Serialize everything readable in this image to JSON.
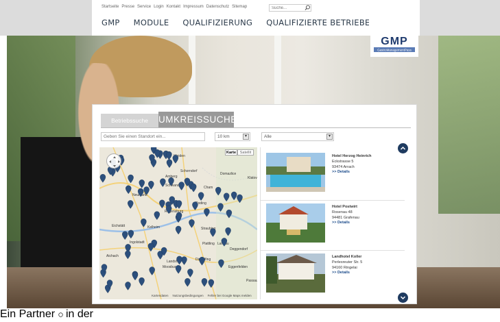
{
  "meta_nav": [
    "Startseite",
    "Presse",
    "Service",
    "Login",
    "Kontakt",
    "Impressum",
    "Datenschutz",
    "Sitemap"
  ],
  "search": {
    "placeholder": "Suche..."
  },
  "main_nav": [
    "GMP",
    "MODULE",
    "QUALIFIZIERUNG",
    "QUALIFIZIERTE BETRIEBE"
  ],
  "logo": {
    "text": "GMP",
    "subtext": "GastroManagementPass"
  },
  "tabs": {
    "inactive": "Betriebssuche",
    "active": "UMKREISSUCHE"
  },
  "filters": {
    "location_placeholder": "Geben Sie einen Standort ein...",
    "radius": "10 km",
    "category": "Alle"
  },
  "map": {
    "type_buttons": [
      "Karte",
      "Satellit"
    ],
    "labels": [
      "Weiden",
      "Schwandorf",
      "Amberg",
      "Neumarkt",
      "Roding",
      "Cham",
      "Regensburg",
      "Straubing",
      "Deggendorf",
      "Plattling",
      "Landau",
      "Dingolfing",
      "Landshut",
      "Aichach",
      "Moosburg",
      "Eggenfelden",
      "Passau",
      "Klatovy",
      "Domazlice",
      "Eichstätt",
      "Ingolstadt",
      "Kelheim",
      "Schorndorf"
    ],
    "footer": [
      "Kartendaten",
      "Nutzungsbedingungen",
      "Fehler bei Google Maps melden"
    ]
  },
  "hotels": [
    {
      "name": "Hotel Herzog Heinrich",
      "street": "Eckstrasse 5",
      "city": "93474 Arrach",
      "link": ">> Details"
    },
    {
      "name": "Hotel Postwirt",
      "street": "Rosenau 48",
      "city": "94481 Grafenau",
      "link": ">> Details"
    },
    {
      "name": "Landhotel Koller",
      "street": "Perlesreuter Str. 5",
      "city": "94160 Ringelai",
      "link": ">> Details"
    }
  ],
  "footer": {
    "copyright": "© ...",
    "right_links": [
      "Ein Partner",
      "in der"
    ]
  },
  "colors": {
    "nav_text": "#2b3a4a",
    "tab_active": "#999999",
    "tab_inactive": "#d4d4d4",
    "marker": "#2c4f7c",
    "scroll_button": "#1f3b60",
    "link": "#1a4a8a"
  }
}
